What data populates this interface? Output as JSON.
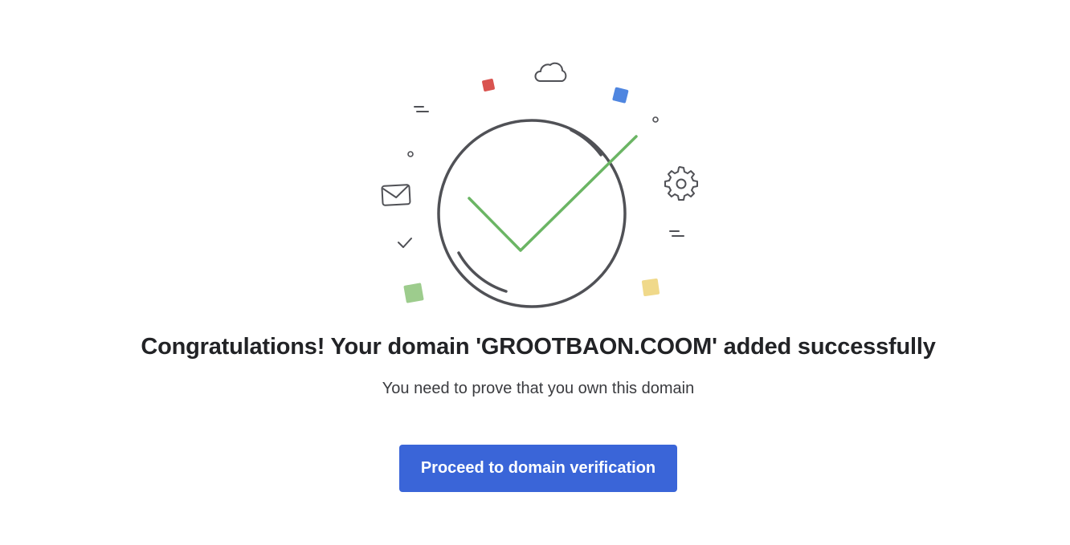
{
  "success": {
    "title": "Congratulations! Your domain 'GROOTBAON.COOM' added successfully",
    "subtitle": "You need to prove that you own this domain",
    "button_label": "Proceed to domain verification"
  },
  "colors": {
    "button_bg": "#3a65d8",
    "check": "#6bb564",
    "outline": "#505156",
    "square_red": "#d9534f",
    "square_blue": "#4f86e0",
    "square_green": "#9dcc8d",
    "square_yellow": "#f0d98a"
  },
  "icons": [
    "checkmark-circle-icon",
    "cloud-icon",
    "envelope-icon",
    "gear-icon",
    "small-check-icon"
  ]
}
